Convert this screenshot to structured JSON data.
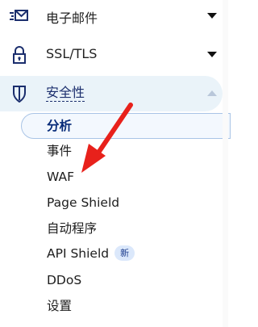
{
  "sidebar": {
    "items": [
      {
        "label": "电子邮件",
        "icon": "email-routing-icon",
        "chevron": "chevron-down-icon"
      },
      {
        "label": "SSL/TLS",
        "icon": "lock-icon",
        "chevron": "chevron-down-icon"
      },
      {
        "label": "安全性",
        "icon": "shield-icon",
        "chevron": "chevron-up-icon",
        "expanded": true
      }
    ],
    "security_subitems": [
      {
        "label": "分析",
        "selected": true
      },
      {
        "label": "事件"
      },
      {
        "label": "WAF"
      },
      {
        "label": "Page Shield"
      },
      {
        "label": "自动程序"
      },
      {
        "label": "API Shield",
        "badge": "新"
      },
      {
        "label": "DDoS"
      },
      {
        "label": "设置"
      }
    ]
  },
  "colors": {
    "active_bg": "#eaf3f9",
    "accent_navy": "#062a78",
    "annotation_arrow": "#e8211b",
    "badge_bg": "#dbe8fb"
  }
}
